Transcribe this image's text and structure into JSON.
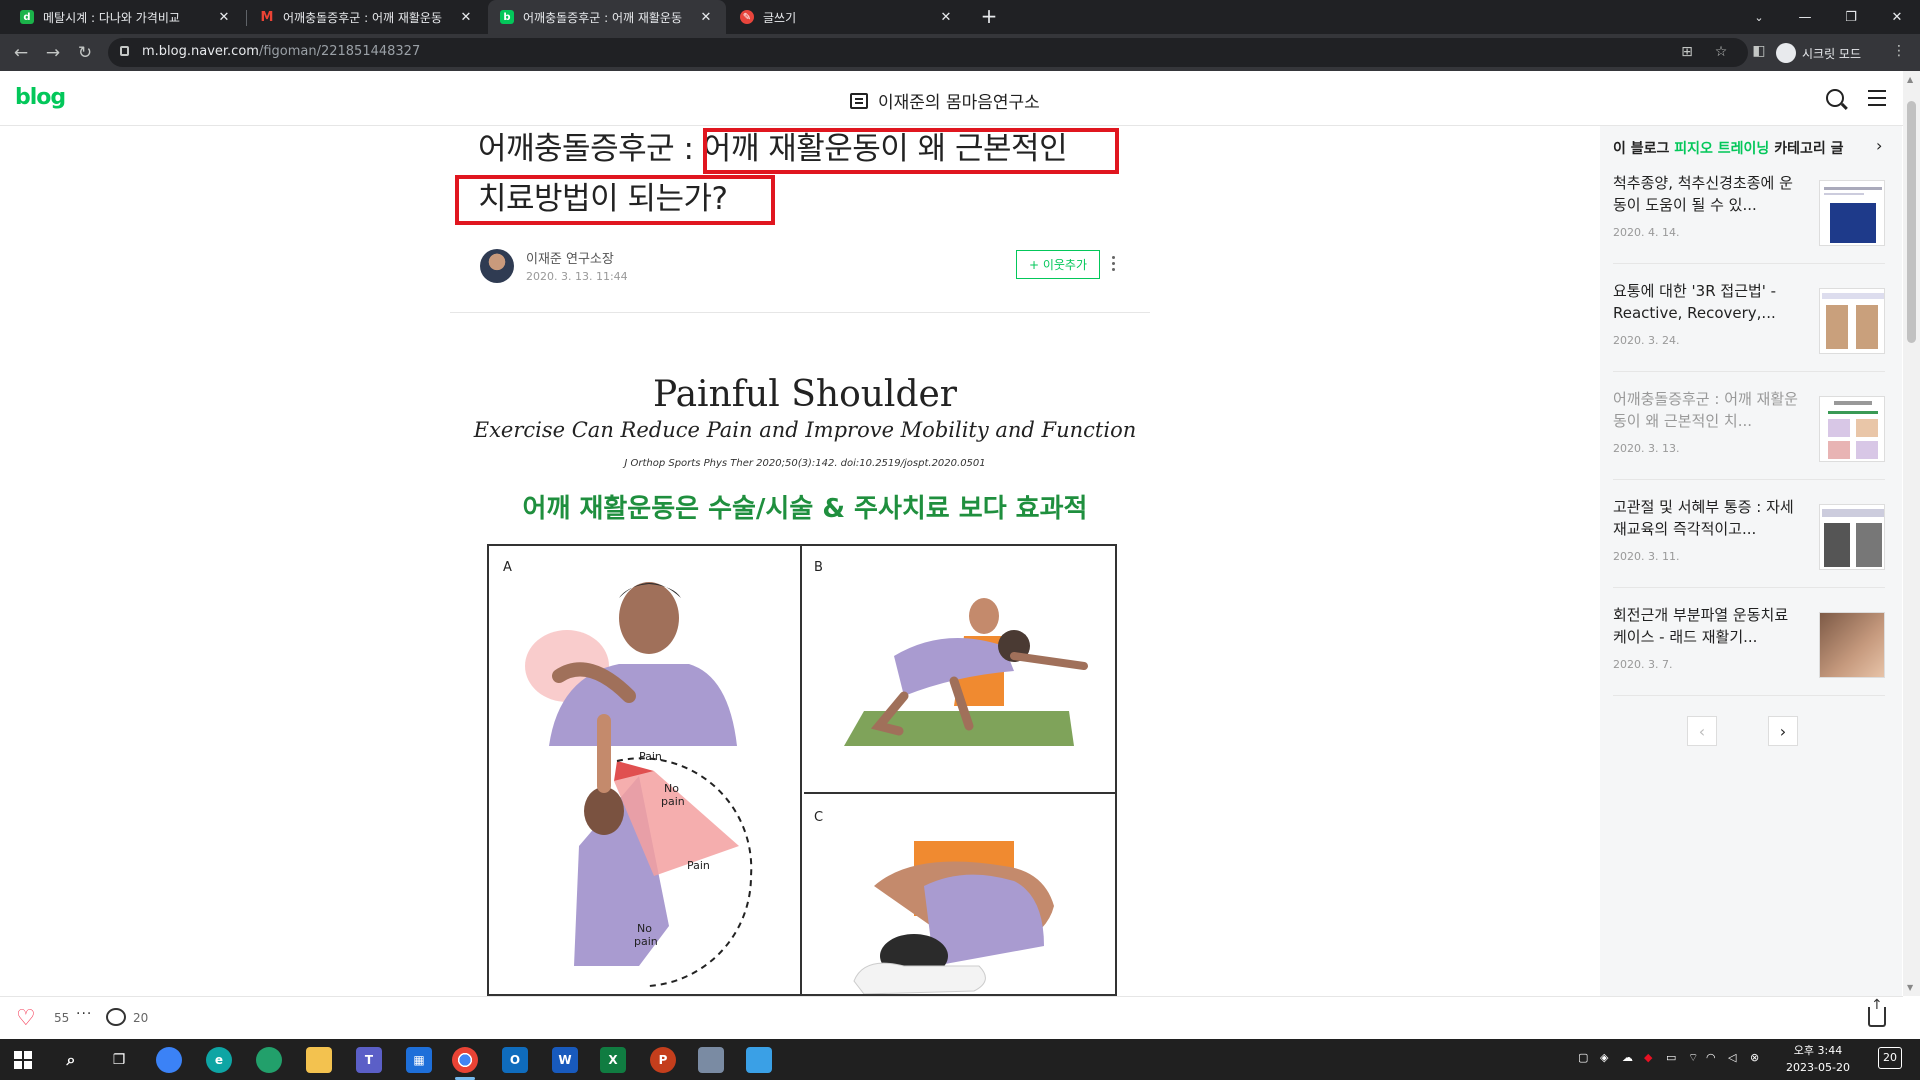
{
  "browser": {
    "tabs": [
      {
        "title": "메탈시계 : 다나와 가격비교",
        "favicon": "danawa-icon",
        "active": false
      },
      {
        "title": "어깨충돌증후군 : 어깨 재활운동",
        "favicon": "gmail-icon",
        "active": false
      },
      {
        "title": "어깨충돌증후군 : 어깨 재활운동",
        "favicon": "naver-blog-icon",
        "active": true
      },
      {
        "title": "글쓰기",
        "favicon": "write-icon",
        "active": false
      }
    ],
    "url_host": "m.blog.naver.com",
    "url_path": "/figoman/221851448327",
    "incognito_label": "시크릿 모드"
  },
  "blog": {
    "logo": "blog",
    "name": "이재준의 몸마음연구소"
  },
  "post": {
    "title_line1_plain": "어깨충돌증후군 : ",
    "title_line1_highlight": "어깨 재활운동이 왜 근본적인",
    "title_line2_highlight": "치료방법이 되는가?",
    "author": "이재준 연구소장",
    "date": "2020. 3. 13. 11:44",
    "follow_label": "+ 이웃추가"
  },
  "figure": {
    "title": "Painful Shoulder",
    "subtitle": "Exercise Can Reduce Pain and Improve Mobility and Function",
    "citation": "J Orthop Sports Phys Ther 2020;50(3):142. doi:10.2519/jospt.2020.0501",
    "korean_caption": "어깨 재활운동은 수술/시술 & 주사치료 보다 효과적",
    "panel_a": "A",
    "panel_b": "B",
    "panel_c": "C",
    "arc_labels": [
      "Pain",
      "No pain",
      "Pain",
      "No pain"
    ]
  },
  "sidebar": {
    "heading_prefix": "이 블로그 ",
    "heading_category": "피지오 트레이닝",
    "heading_suffix": " 카테고리 글",
    "items": [
      {
        "title": "척추종양, 척추신경초종에 운동이 도움이 될 수 있...",
        "date": "2020. 4. 14.",
        "current": false
      },
      {
        "title": "요통에 대한 '3R 접근법' - Reactive, Recovery,...",
        "date": "2020. 3. 24.",
        "current": false
      },
      {
        "title": "어깨충돌증후군 : 어깨 재활운동이 왜 근본적인 치...",
        "date": "2020. 3. 13.",
        "current": true
      },
      {
        "title": "고관절 및 서혜부 통증 : 자세 재교육의 즉각적이고...",
        "date": "2020. 3. 11.",
        "current": false
      },
      {
        "title": "회전근개 부분파열 운동치료 케이스 - 래드 재활기...",
        "date": "2020. 3. 7.",
        "current": false
      }
    ]
  },
  "actions": {
    "likes": "55",
    "comments": "20"
  },
  "taskbar": {
    "time": "오후 3:44",
    "date": "2023-05-20",
    "notifications": "20"
  }
}
